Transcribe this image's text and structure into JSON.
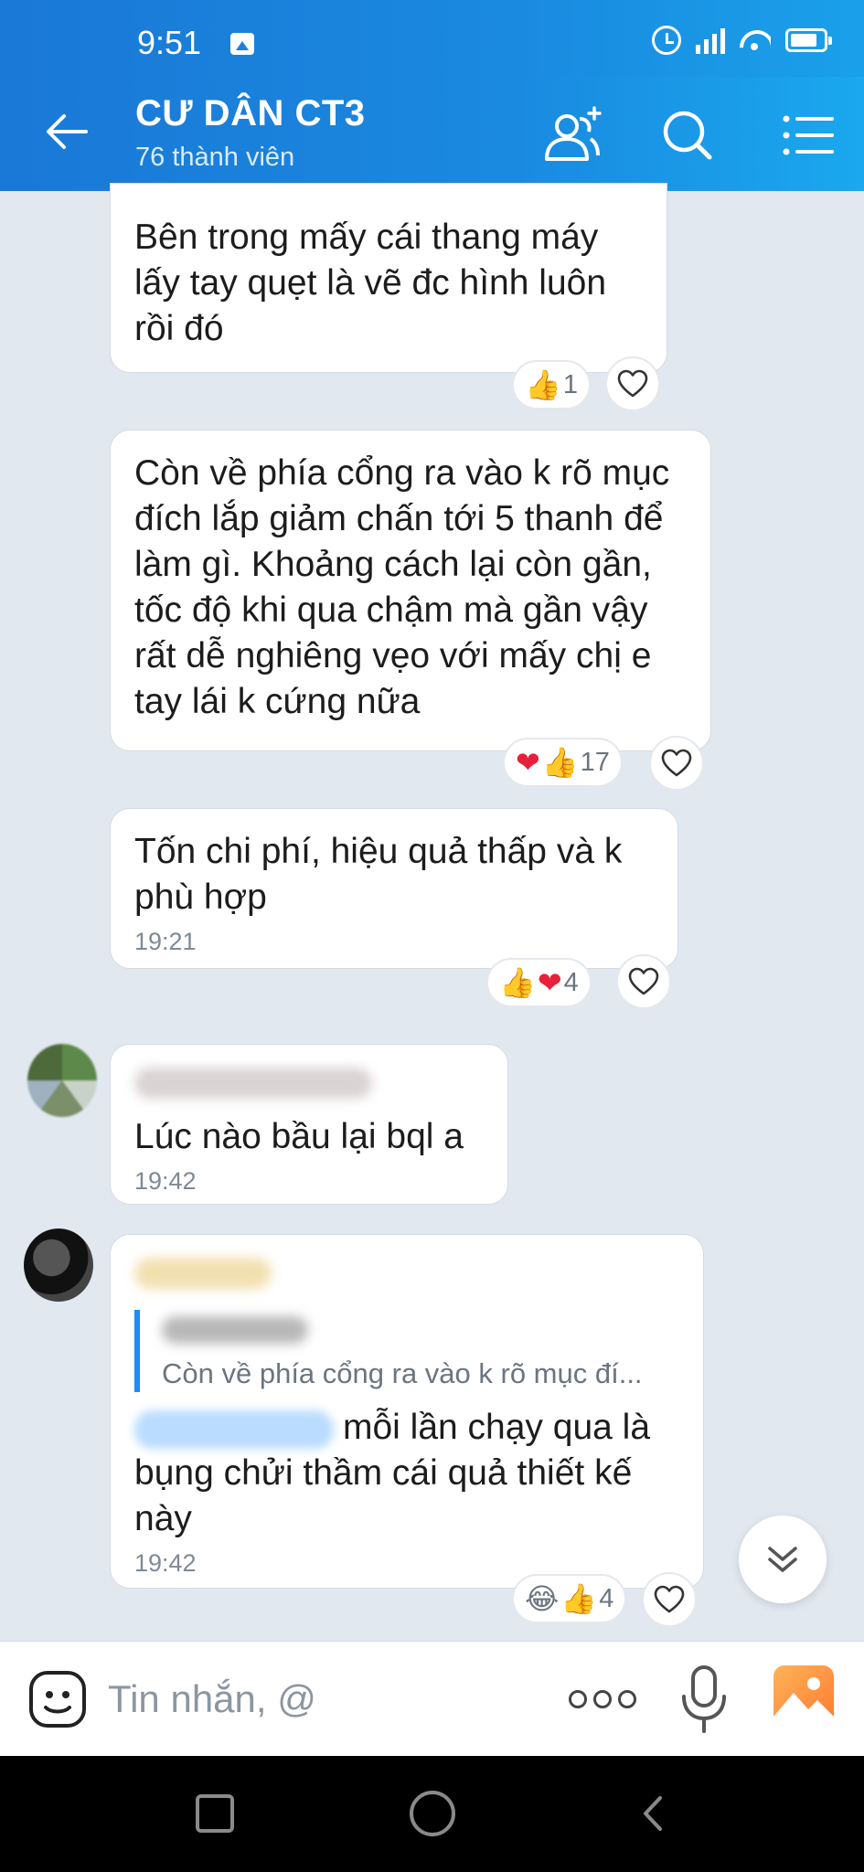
{
  "status_bar": {
    "time": "9:51"
  },
  "header": {
    "title": "CƯ DÂN CT3",
    "subtitle": "76 thành viên"
  },
  "messages": [
    {
      "text": "Bên trong mấy cái thang máy lấy tay quẹt là vẽ đc hình luôn rồi đó",
      "reactions": {
        "emojis": [
          "like"
        ],
        "count": "1"
      }
    },
    {
      "text": "Còn về phía cổng ra vào k rõ mục đích lắp giảm chấn tới 5 thanh để làm gì. Khoảng cách lại còn gần, tốc độ khi qua chậm mà gần vậy rất dễ nghiêng vẹo với mấy chị e tay lái k cứng nữa",
      "reactions": {
        "emojis": [
          "heart",
          "like"
        ],
        "count": "17"
      }
    },
    {
      "text": "Tốn chi phí, hiệu quả thấp và k phù hợp",
      "time": "19:21",
      "reactions": {
        "emojis": [
          "like",
          "heart"
        ],
        "count": "4"
      }
    },
    {
      "text": "Lúc nào bầu lại bql a",
      "time": "19:42"
    },
    {
      "quote_text": "Còn về phía cổng ra vào k rõ mục đí...",
      "text": "mỗi lần chạy qua là bụng chửi thầm cái quả thiết kế này",
      "time": "19:42",
      "reactions": {
        "emojis": [
          "laugh",
          "like"
        ],
        "count": "4"
      }
    }
  ],
  "composer": {
    "placeholder": "Tin nhắn, @"
  }
}
